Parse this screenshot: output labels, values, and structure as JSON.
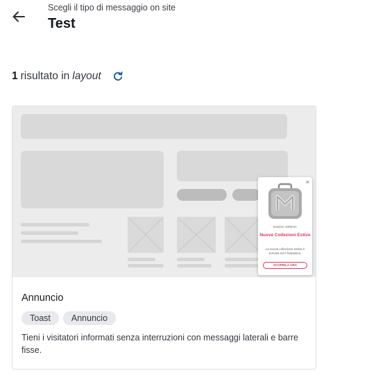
{
  "header": {
    "subtitle": "Scegli il tipo di messaggio on site",
    "title": "Test"
  },
  "results": {
    "count": "1",
    "text": "risultato in",
    "scope": "layout"
  },
  "card": {
    "title": "Annuncio",
    "tags": [
      "Toast",
      "Annuncio"
    ],
    "description": "Tieni i visitatori informati senza interruzioni con messaggi laterali e barre fisse.",
    "preview_toast": {
      "close": "×",
      "kicker": "NUOVI ARRIVI",
      "headline": "Nuove Collezioni Estive",
      "body": "La nuova collezione estiva è arrivata ed è fantastica.",
      "button": "SCOPRILA ORA"
    }
  },
  "colors": {
    "accent": "#e0385a",
    "refresh": "#1c5fa8"
  }
}
